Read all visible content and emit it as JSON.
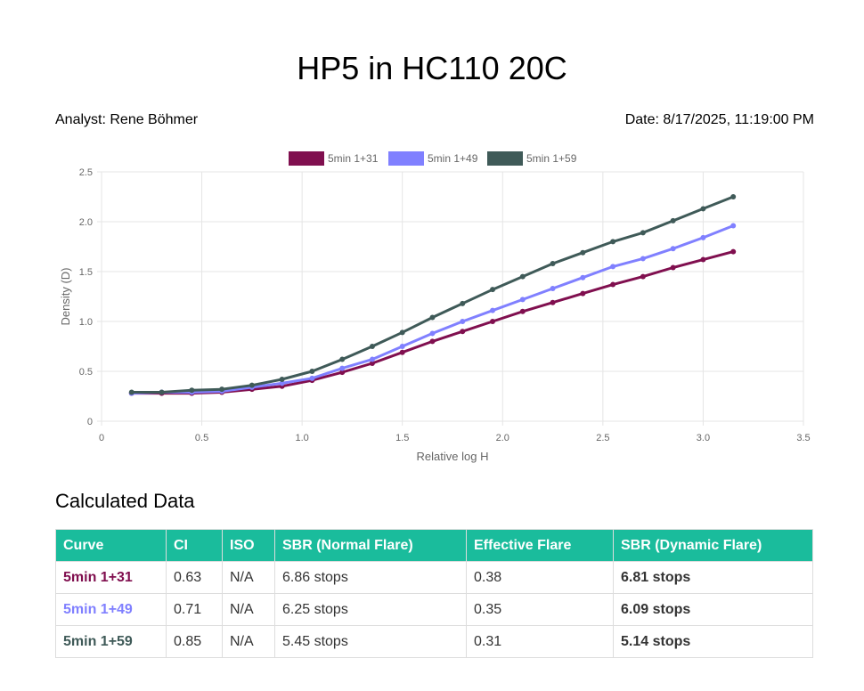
{
  "title": "HP5 in HC110 20C",
  "analyst": "Analyst: Rene Böhmer",
  "date": "Date: 8/17/2025, 11:19:00 PM",
  "chart_data": {
    "type": "line",
    "xlabel": "Relative log H",
    "ylabel": "Density (D)",
    "xlim": [
      0,
      3.5
    ],
    "ylim": [
      0,
      2.5
    ],
    "xticks": [
      "0",
      "0.5",
      "1.0",
      "1.5",
      "2.0",
      "2.5",
      "3.0",
      "3.5"
    ],
    "yticks": [
      "0",
      "0.5",
      "1.0",
      "1.5",
      "2.0",
      "2.5"
    ],
    "grid": true,
    "legend_position": "top",
    "x": [
      0.15,
      0.3,
      0.45,
      0.6,
      0.75,
      0.9,
      1.05,
      1.2,
      1.35,
      1.5,
      1.65,
      1.8,
      1.95,
      2.1,
      2.25,
      2.4,
      2.55,
      2.7,
      2.85,
      3.0,
      3.15
    ],
    "series": [
      {
        "name": "5min 1+31",
        "color": "#800f4f",
        "values": [
          0.28,
          0.28,
          0.28,
          0.29,
          0.32,
          0.35,
          0.41,
          0.49,
          0.58,
          0.69,
          0.8,
          0.9,
          1.0,
          1.1,
          1.19,
          1.28,
          1.37,
          1.45,
          1.54,
          1.62,
          1.7
        ]
      },
      {
        "name": "5min 1+49",
        "color": "#8080ff",
        "values": [
          0.28,
          0.29,
          0.29,
          0.3,
          0.34,
          0.38,
          0.43,
          0.53,
          0.62,
          0.75,
          0.88,
          1.0,
          1.11,
          1.22,
          1.33,
          1.44,
          1.55,
          1.63,
          1.73,
          1.84,
          1.96
        ]
      },
      {
        "name": "5min 1+59",
        "color": "#3f5a58",
        "values": [
          0.29,
          0.29,
          0.31,
          0.32,
          0.36,
          0.42,
          0.5,
          0.62,
          0.75,
          0.89,
          1.04,
          1.18,
          1.32,
          1.45,
          1.58,
          1.69,
          1.8,
          1.89,
          2.01,
          2.13,
          2.25
        ]
      }
    ]
  },
  "table": {
    "title": "Calculated Data",
    "headers": [
      "Curve",
      "CI",
      "ISO",
      "SBR (Normal Flare)",
      "Effective Flare",
      "SBR (Dynamic Flare)"
    ],
    "rows": [
      {
        "curve": "5min 1+31",
        "color": "#800f4f",
        "ci": "0.63",
        "iso": "N/A",
        "sbr_normal": "6.86 stops",
        "flare": "0.38",
        "sbr_dynamic": "6.81 stops"
      },
      {
        "curve": "5min 1+49",
        "color": "#8080ff",
        "ci": "0.71",
        "iso": "N/A",
        "sbr_normal": "6.25 stops",
        "flare": "0.35",
        "sbr_dynamic": "6.09 stops"
      },
      {
        "curve": "5min 1+59",
        "color": "#3f5a58",
        "ci": "0.85",
        "iso": "N/A",
        "sbr_normal": "5.45 stops",
        "flare": "0.31",
        "sbr_dynamic": "5.14 stops"
      }
    ]
  }
}
